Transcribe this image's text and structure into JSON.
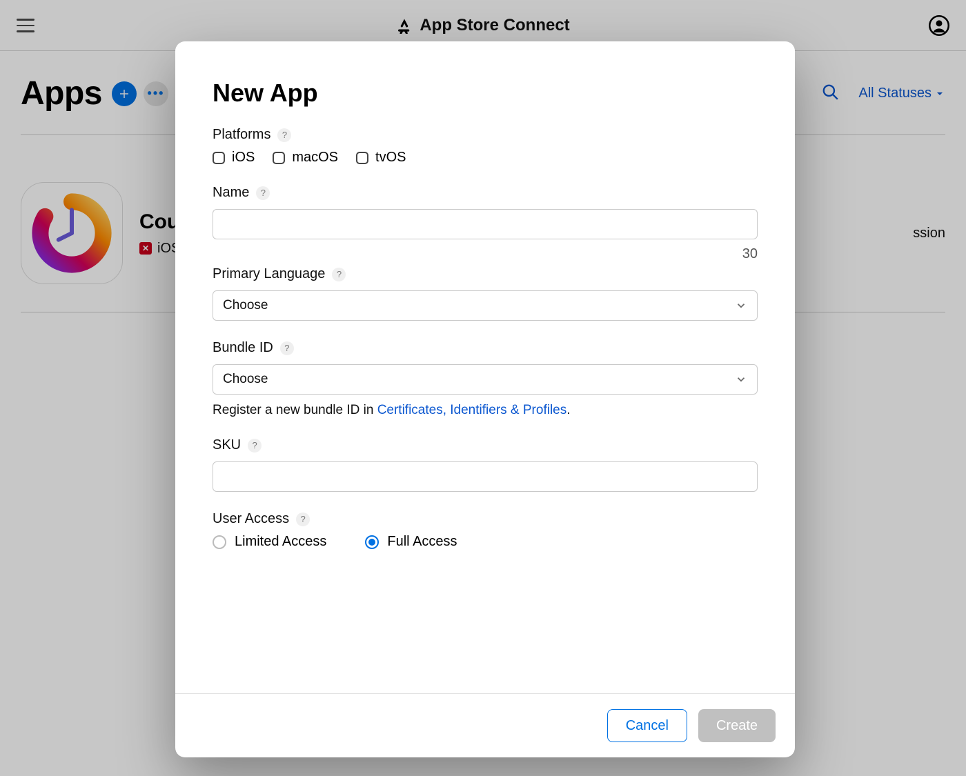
{
  "header": {
    "brand": "App Store Connect",
    "page_title": "Apps",
    "status_filter_label": "All Statuses"
  },
  "app_card": {
    "name_visible": "Cou",
    "platform_label": "iOS",
    "right_text": "ssion"
  },
  "modal": {
    "title": "New App",
    "platforms": {
      "label": "Platforms",
      "options": {
        "ios": "iOS",
        "macos": "macOS",
        "tvos": "tvOS"
      }
    },
    "name": {
      "label": "Name",
      "char_limit": "30"
    },
    "primary_language": {
      "label": "Primary Language",
      "placeholder": "Choose"
    },
    "bundle_id": {
      "label": "Bundle ID",
      "placeholder": "Choose",
      "hint_prefix": "Register a new bundle ID in ",
      "hint_link": "Certificates, Identifiers & Profiles",
      "hint_suffix": "."
    },
    "sku": {
      "label": "SKU"
    },
    "user_access": {
      "label": "User Access",
      "options": {
        "limited": "Limited Access",
        "full": "Full Access"
      },
      "selected": "full"
    },
    "buttons": {
      "cancel": "Cancel",
      "create": "Create"
    }
  }
}
